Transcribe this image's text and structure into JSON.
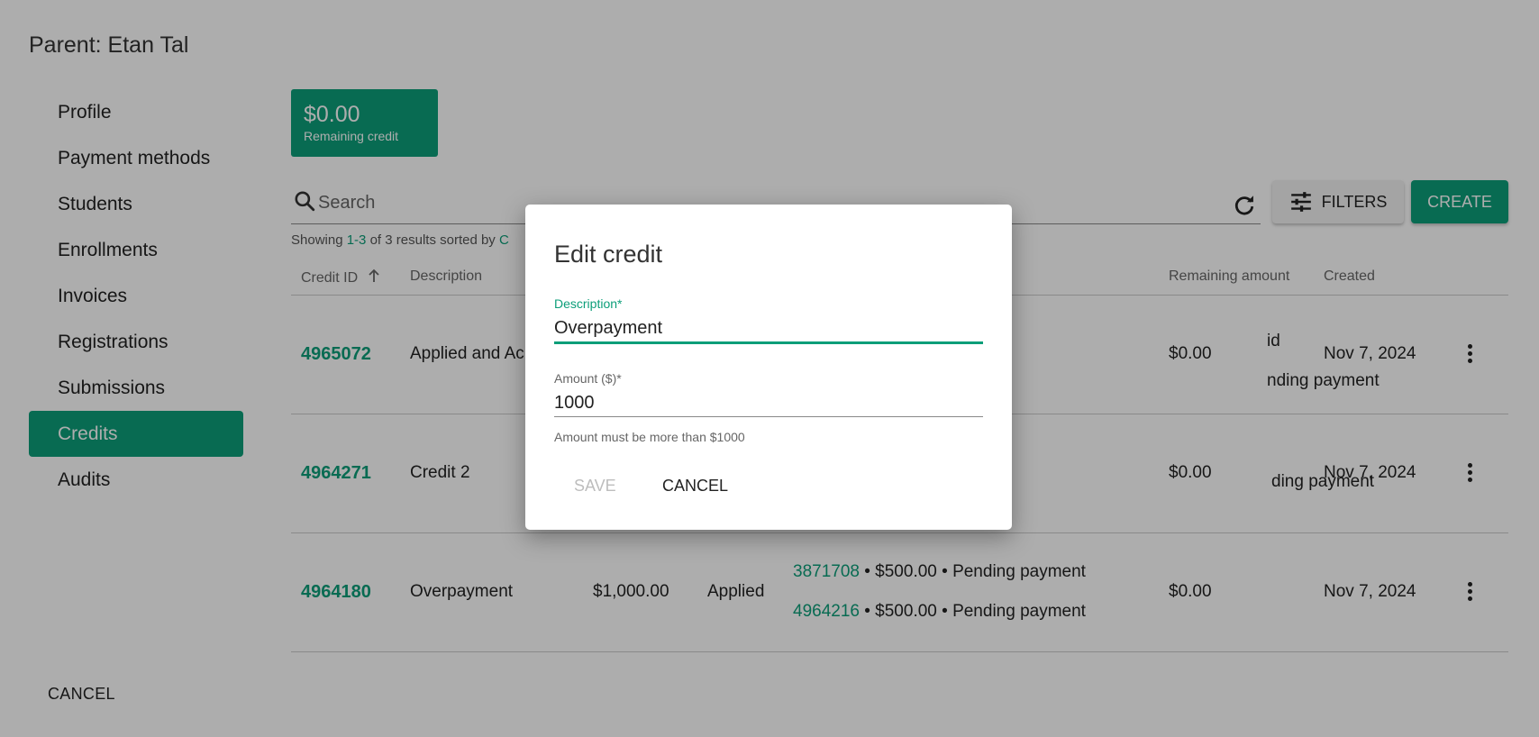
{
  "page": {
    "parent_title": "Parent: Etan Tal",
    "footer_cancel": "CANCEL"
  },
  "sidebar": {
    "items": [
      {
        "label": "Profile",
        "active": false
      },
      {
        "label": "Payment methods",
        "active": false
      },
      {
        "label": "Students",
        "active": false
      },
      {
        "label": "Enrollments",
        "active": false
      },
      {
        "label": "Invoices",
        "active": false
      },
      {
        "label": "Registrations",
        "active": false
      },
      {
        "label": "Submissions",
        "active": false
      },
      {
        "label": "Credits",
        "active": true
      },
      {
        "label": "Audits",
        "active": false
      }
    ]
  },
  "summary": {
    "amount": "$0.00",
    "label": "Remaining credit"
  },
  "toolbar": {
    "search_placeholder": "Search",
    "filters_label": "FILTERS",
    "create_label": "CREATE",
    "search_icon": "search-icon",
    "refresh_icon": "refresh-icon",
    "filters_icon": "tune-icon"
  },
  "results": {
    "prefix": "Showing ",
    "range": "1-3",
    "middle": " of 3 results sorted by ",
    "sort_field": "C"
  },
  "table": {
    "headers": {
      "credit_id": "Credit ID",
      "description": "Description",
      "remaining": "Remaining amount",
      "created": "Created"
    },
    "sort_icon": "arrow-up-icon",
    "rows": [
      {
        "id": "4965072",
        "description": "Applied and Ac",
        "amount": "",
        "status": "",
        "app1_link": "",
        "app1_text": "id",
        "app2_link": "",
        "app2_text": "nding payment",
        "remaining": "$0.00",
        "created": "Nov 7, 2024"
      },
      {
        "id": "4964271",
        "description": "Credit 2",
        "amount": "",
        "status": "",
        "app1_link": "",
        "app1_text": "",
        "app2_link": "",
        "app2_text": "ding payment",
        "remaining": "$0.00",
        "created": "Nov 7, 2024"
      },
      {
        "id": "4964180",
        "description": "Overpayment",
        "amount": "$1,000.00",
        "status": "Applied",
        "app1_link": "3871708",
        "app1_text": " • $500.00 • Pending payment",
        "app2_link": "4964216",
        "app2_text": " • $500.00 • Pending payment",
        "remaining": "$0.00",
        "created": "Nov 7, 2024"
      }
    ]
  },
  "dialog": {
    "title": "Edit credit",
    "description_label": "Description*",
    "description_value": "Overpayment",
    "amount_label": "Amount ($)*",
    "amount_value": "1000",
    "helper": "Amount must be more than $1000",
    "save_label": "SAVE",
    "cancel_label": "CANCEL"
  },
  "colors": {
    "accent": "#0c9e79",
    "overlay": "rgba(0,0,0,0.32)"
  }
}
